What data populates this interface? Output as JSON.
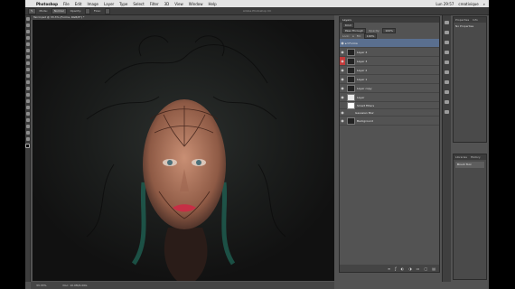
{
  "menubar": {
    "app_name": "Photoshop",
    "items": [
      "File",
      "Edit",
      "Image",
      "Layer",
      "Type",
      "Select",
      "Filter",
      "3D",
      "View",
      "Window",
      "Help"
    ],
    "clock": "Lun 29:57",
    "user": "creativique"
  },
  "window_title": "Adobe Photoshop CC",
  "options_bar": {
    "mode_label": "Mode:",
    "mode_value": "Normal",
    "opacity_label": "Opacity:",
    "flow_label": "Flow:"
  },
  "document_tab": "Tercil.psd @ 33.3% (Forma, RGB/8*) *",
  "status": {
    "zoom": "33.33%",
    "doc": "Doc: 10.0M/4.00G"
  },
  "layers_panel": {
    "title": "Layers",
    "kind": "Kind",
    "blend_mode": "Pass Through",
    "opacity_label": "Opacity:",
    "opacity": "100%",
    "lock_label": "Lock:",
    "fill_label": "Fill:",
    "fill": "100%",
    "layers": [
      {
        "name": "Forma",
        "selected": true
      },
      {
        "name": "Layer 4"
      },
      {
        "name": "Layer 3"
      },
      {
        "name": "Layer 2"
      },
      {
        "name": "Layer 1"
      },
      {
        "name": "Layer copy"
      },
      {
        "name": "Layer"
      },
      {
        "name": "Smart Filters"
      },
      {
        "name": "Gaussian Blur"
      },
      {
        "name": "Background"
      }
    ]
  },
  "properties_panel": {
    "tab1": "Properties",
    "tab2": "Info",
    "body": "No Properties"
  },
  "history_panel": {
    "tab1": "Libraries",
    "tab2": "History",
    "row": "Brush Tool"
  },
  "colors": {
    "canvas_bg": "#141414",
    "selection": "#5a6f8f",
    "ui_bg": "#535353"
  }
}
